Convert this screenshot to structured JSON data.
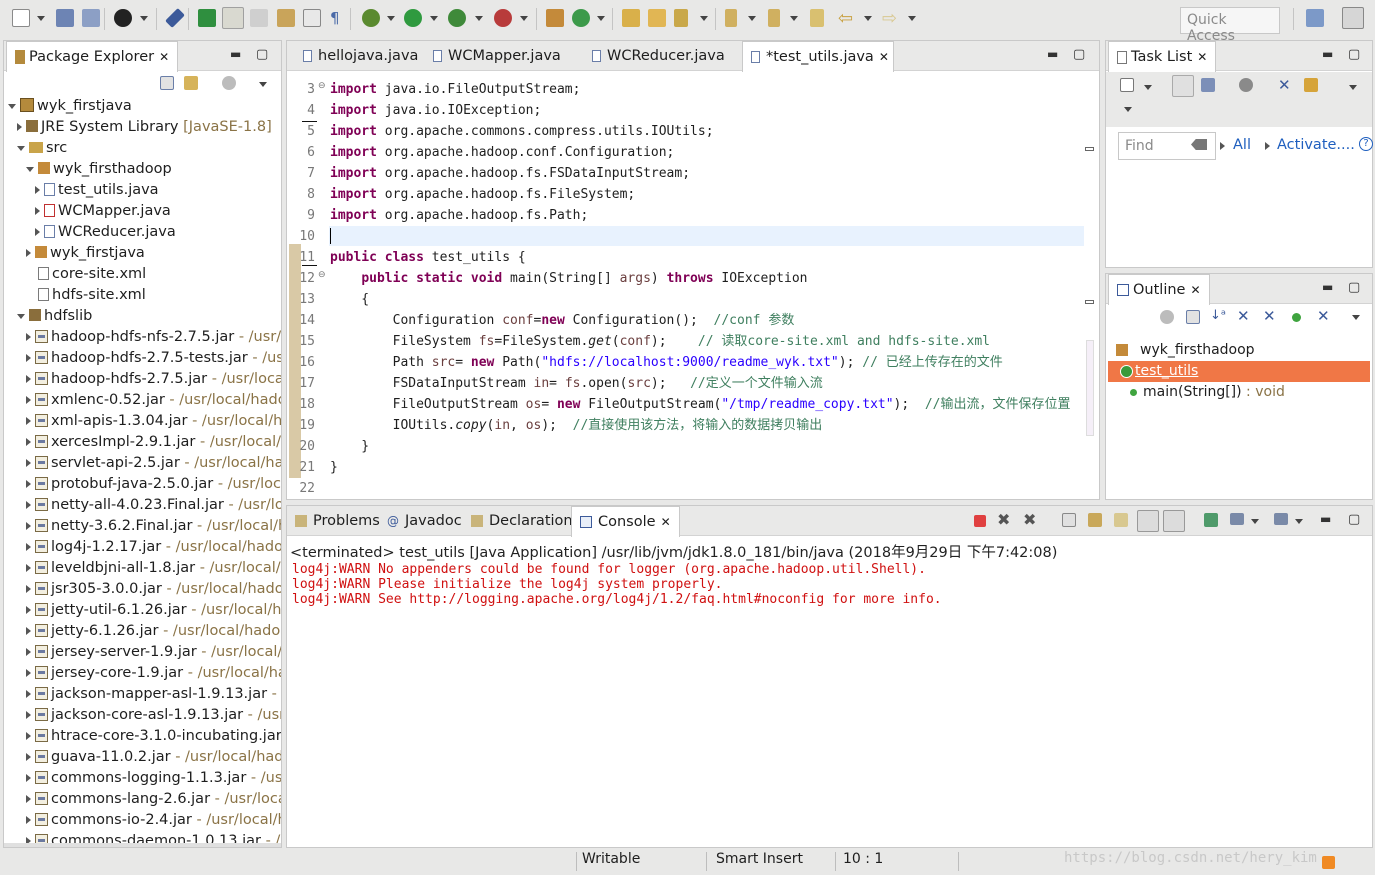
{
  "toolbar": {
    "quick_access_placeholder": "Quick Access",
    "icons": [
      "new-icon",
      "save-icon",
      "save-all-icon",
      "user-icon",
      "skip-breakpoints-icon",
      "new-package-icon",
      "highlight-icon",
      "toggle-mark-icon",
      "open-type-icon",
      "show-whitespace-icon",
      "paragraph-icon",
      "debug-icon",
      "run-icon",
      "run-coverage-icon",
      "external-tools-icon",
      "new-class-icon",
      "new-interface-icon",
      "open-folder-icon",
      "open-task-icon",
      "search-icon",
      "next-annotation-icon",
      "prev-annotation-icon",
      "last-edit-icon",
      "back-icon",
      "forward-icon",
      "open-perspective-icon",
      "java-perspective-icon"
    ]
  },
  "package_explorer": {
    "title": "Package Explorer",
    "tree": [
      {
        "label": "wyk_firstjava",
        "depth": 0,
        "expanded": true,
        "icon": "java-project-icon"
      },
      {
        "label": "JRE System Library",
        "suffix": "[JavaSE-1.8]",
        "depth": 1,
        "expanded": false,
        "icon": "library-icon"
      },
      {
        "label": "src",
        "depth": 1,
        "expanded": true,
        "icon": "source-folder-icon"
      },
      {
        "label": "wyk_firsthadoop",
        "depth": 2,
        "expanded": true,
        "icon": "package-icon"
      },
      {
        "label": "test_utils.java",
        "depth": 3,
        "expanded": false,
        "icon": "java-file-icon"
      },
      {
        "label": "WCMapper.java",
        "depth": 3,
        "expanded": false,
        "icon": "java-file-error-icon"
      },
      {
        "label": "WCReducer.java",
        "depth": 3,
        "expanded": false,
        "icon": "java-file-icon"
      },
      {
        "label": "wyk_firstjava",
        "depth": 2,
        "expanded": false,
        "icon": "package-icon"
      },
      {
        "label": "core-site.xml",
        "depth": 2,
        "leaf": true,
        "icon": "xml-file-icon"
      },
      {
        "label": "hdfs-site.xml",
        "depth": 2,
        "leaf": true,
        "icon": "xml-file-icon"
      },
      {
        "label": "hdfslib",
        "depth": 1,
        "expanded": true,
        "icon": "library-icon"
      },
      {
        "label": "hadoop-hdfs-nfs-2.7.5.jar",
        "suffix": "- /usr/lo",
        "depth": 2,
        "icon": "jar-icon"
      },
      {
        "label": "hadoop-hdfs-2.7.5-tests.jar",
        "suffix": "- /usr/",
        "depth": 2,
        "icon": "jar-icon"
      },
      {
        "label": "hadoop-hdfs-2.7.5.jar",
        "suffix": "- /usr/local/",
        "depth": 2,
        "icon": "jar-icon"
      },
      {
        "label": "xmlenc-0.52.jar",
        "suffix": "- /usr/local/hadoo",
        "depth": 2,
        "icon": "jar-icon"
      },
      {
        "label": "xml-apis-1.3.04.jar",
        "suffix": "- /usr/local/had",
        "depth": 2,
        "icon": "jar-icon"
      },
      {
        "label": "xercesImpl-2.9.1.jar",
        "suffix": "- /usr/local/ha",
        "depth": 2,
        "icon": "jar-icon"
      },
      {
        "label": "servlet-api-2.5.jar",
        "suffix": "- /usr/local/hado",
        "depth": 2,
        "icon": "jar-icon"
      },
      {
        "label": "protobuf-java-2.5.0.jar",
        "suffix": "- /usr/local/",
        "depth": 2,
        "icon": "jar-icon"
      },
      {
        "label": "netty-all-4.0.23.Final.jar",
        "suffix": "- /usr/local",
        "depth": 2,
        "icon": "jar-icon"
      },
      {
        "label": "netty-3.6.2.Final.jar",
        "suffix": "- /usr/local/ha",
        "depth": 2,
        "icon": "jar-icon"
      },
      {
        "label": "log4j-1.2.17.jar",
        "suffix": "- /usr/local/hadoop",
        "depth": 2,
        "icon": "jar-icon"
      },
      {
        "label": "leveldbjni-all-1.8.jar",
        "suffix": "- /usr/local/ha",
        "depth": 2,
        "icon": "jar-icon"
      },
      {
        "label": "jsr305-3.0.0.jar",
        "suffix": "- /usr/local/hadoop",
        "depth": 2,
        "icon": "jar-icon"
      },
      {
        "label": "jetty-util-6.1.26.jar",
        "suffix": "- /usr/local/hac",
        "depth": 2,
        "icon": "jar-icon"
      },
      {
        "label": "jetty-6.1.26.jar",
        "suffix": "- /usr/local/hadoop",
        "depth": 2,
        "icon": "jar-icon"
      },
      {
        "label": "jersey-server-1.9.jar",
        "suffix": "- /usr/local/ha",
        "depth": 2,
        "icon": "jar-icon"
      },
      {
        "label": "jersey-core-1.9.jar",
        "suffix": "- /usr/local/had",
        "depth": 2,
        "icon": "jar-icon"
      },
      {
        "label": "jackson-mapper-asl-1.9.13.jar",
        "suffix": "- /us",
        "depth": 2,
        "icon": "jar-icon"
      },
      {
        "label": "jackson-core-asl-1.9.13.jar",
        "suffix": "- /usr/lc",
        "depth": 2,
        "icon": "jar-icon"
      },
      {
        "label": "htrace-core-3.1.0-incubating.jar",
        "suffix": "- /",
        "depth": 2,
        "icon": "jar-icon"
      },
      {
        "label": "guava-11.0.2.jar",
        "suffix": "- /usr/local/hadoo",
        "depth": 2,
        "icon": "jar-icon"
      },
      {
        "label": "commons-logging-1.1.3.jar",
        "suffix": "- /usr/l",
        "depth": 2,
        "icon": "jar-icon"
      },
      {
        "label": "commons-lang-2.6.jar",
        "suffix": "- /usr/local/",
        "depth": 2,
        "icon": "jar-icon"
      },
      {
        "label": "commons-io-2.4.jar",
        "suffix": "- /usr/local/ha",
        "depth": 2,
        "icon": "jar-icon"
      },
      {
        "label": "commons-daemon-1.0.13.jar",
        "suffix": "- /usi",
        "depth": 2,
        "icon": "jar-icon"
      }
    ]
  },
  "editor": {
    "tabs": [
      {
        "label": "hellojava.java",
        "active": false
      },
      {
        "label": "WCMapper.java",
        "active": false
      },
      {
        "label": "WCReducer.java",
        "active": false
      },
      {
        "label": "*test_utils.java",
        "active": true
      }
    ],
    "line_numbers": [
      "3",
      "4",
      "5",
      "6",
      "7",
      "8",
      "9",
      "10",
      "11",
      "12",
      "13",
      "14",
      "15",
      "16",
      "17",
      "18",
      "19",
      "20",
      "21",
      "22"
    ],
    "lines": [
      [
        {
          "t": "import ",
          "c": "kw"
        },
        {
          "t": "java.io.FileOutputStream;"
        }
      ],
      [
        {
          "t": "import ",
          "c": "kw"
        },
        {
          "t": "java.io.IOException;"
        }
      ],
      [
        {
          "t": "import ",
          "c": "kw"
        },
        {
          "t": "org.apache.commons.compress.utils.IOUtils;"
        }
      ],
      [
        {
          "t": "import ",
          "c": "kw"
        },
        {
          "t": "org.apache.hadoop.conf.Configuration;"
        }
      ],
      [
        {
          "t": "import ",
          "c": "kw"
        },
        {
          "t": "org.apache.hadoop.fs.FSDataInputStream;"
        }
      ],
      [
        {
          "t": "import ",
          "c": "kw"
        },
        {
          "t": "org.apache.hadoop.fs.FileSystem;"
        }
      ],
      [
        {
          "t": "import ",
          "c": "kw"
        },
        {
          "t": "org.apache.hadoop.fs.Path;"
        }
      ],
      [],
      [
        {
          "t": "public class ",
          "c": "kw"
        },
        {
          "t": "test_utils {"
        }
      ],
      [
        {
          "t": "    "
        },
        {
          "t": "public static void ",
          "c": "kw"
        },
        {
          "t": "main(String[] "
        },
        {
          "t": "args",
          "c": "var"
        },
        {
          "t": ") "
        },
        {
          "t": "throws ",
          "c": "kw"
        },
        {
          "t": "IOException"
        }
      ],
      [
        {
          "t": "    {"
        }
      ],
      [
        {
          "t": "        Configuration "
        },
        {
          "t": "conf",
          "c": "var"
        },
        {
          "t": "="
        },
        {
          "t": "new ",
          "c": "kw"
        },
        {
          "t": "Configuration();  "
        },
        {
          "t": "//conf 参数",
          "c": "cm"
        }
      ],
      [
        {
          "t": "        FileSystem "
        },
        {
          "t": "fs",
          "c": "var"
        },
        {
          "t": "=FileSystem."
        },
        {
          "t": "get",
          "c": "it"
        },
        {
          "t": "("
        },
        {
          "t": "conf",
          "c": "var"
        },
        {
          "t": ");    "
        },
        {
          "t": "// 读取core-site.xml and hdfs-site.xml",
          "c": "cm"
        }
      ],
      [
        {
          "t": "        Path "
        },
        {
          "t": "src",
          "c": "var"
        },
        {
          "t": "= "
        },
        {
          "t": "new ",
          "c": "kw"
        },
        {
          "t": "Path("
        },
        {
          "t": "\"hdfs://localhost:9000/readme_wyk.txt\"",
          "c": "str"
        },
        {
          "t": "); "
        },
        {
          "t": "// 已经上传存在的文件",
          "c": "cm"
        }
      ],
      [
        {
          "t": "        FSDataInputStream "
        },
        {
          "t": "in",
          "c": "var"
        },
        {
          "t": "= "
        },
        {
          "t": "fs",
          "c": "var"
        },
        {
          "t": ".open("
        },
        {
          "t": "src",
          "c": "var"
        },
        {
          "t": ");   "
        },
        {
          "t": "//定义一个文件输入流",
          "c": "cm"
        }
      ],
      [
        {
          "t": "        FileOutputStream "
        },
        {
          "t": "os",
          "c": "var"
        },
        {
          "t": "= "
        },
        {
          "t": "new ",
          "c": "kw"
        },
        {
          "t": "FileOutputStream("
        },
        {
          "t": "\"/tmp/readme_copy.txt\"",
          "c": "str"
        },
        {
          "t": ");  "
        },
        {
          "t": "//输出流，文件保存位置",
          "c": "cm"
        }
      ],
      [
        {
          "t": "        IOUtils."
        },
        {
          "t": "copy",
          "c": "it"
        },
        {
          "t": "("
        },
        {
          "t": "in",
          "c": "var"
        },
        {
          "t": ", "
        },
        {
          "t": "os",
          "c": "var"
        },
        {
          "t": ");  "
        },
        {
          "t": "//直接使用该方法，将输入的数据拷贝输出",
          "c": "cm"
        }
      ],
      [
        {
          "t": "    }"
        }
      ],
      [
        {
          "t": "}"
        }
      ],
      []
    ]
  },
  "task_list": {
    "title": "Task List",
    "find_placeholder": "Find",
    "all_label": "All",
    "activate_label": "Activate...."
  },
  "outline": {
    "title": "Outline",
    "items": [
      {
        "label": "wyk_firsthadoop",
        "icon": "package-icon"
      },
      {
        "label": "test_utils",
        "icon": "class-icon",
        "selected": true
      },
      {
        "label": "main(String[])",
        "suffix": ": void",
        "icon": "method-icon"
      }
    ]
  },
  "console_panel": {
    "tabs": [
      {
        "label": "Problems",
        "active": false
      },
      {
        "label": "Javadoc",
        "active": false
      },
      {
        "label": "Declaration",
        "active": false
      },
      {
        "label": "Console",
        "active": true
      }
    ],
    "header": "<terminated> test_utils [Java Application] /usr/lib/jvm/jdk1.8.0_181/bin/java (2018年9月29日 下午7:42:08)",
    "lines": [
      "log4j:WARN No appenders could be found for logger (org.apache.hadoop.util.Shell).",
      "log4j:WARN Please initialize the log4j system properly.",
      "log4j:WARN See http://logging.apache.org/log4j/1.2/faq.html#noconfig for more info."
    ]
  },
  "status_bar": {
    "writable": "Writable",
    "insert_mode": "Smart Insert",
    "position": "10 : 1",
    "watermark": "https://blog.csdn.net/hery_kim"
  },
  "colors": {
    "selection": "#f07746",
    "keyword": "#7f0055",
    "string": "#2a00ff",
    "comment": "#3f7f5f",
    "console_error": "#d01010",
    "current_line": "#e8f2fe"
  }
}
